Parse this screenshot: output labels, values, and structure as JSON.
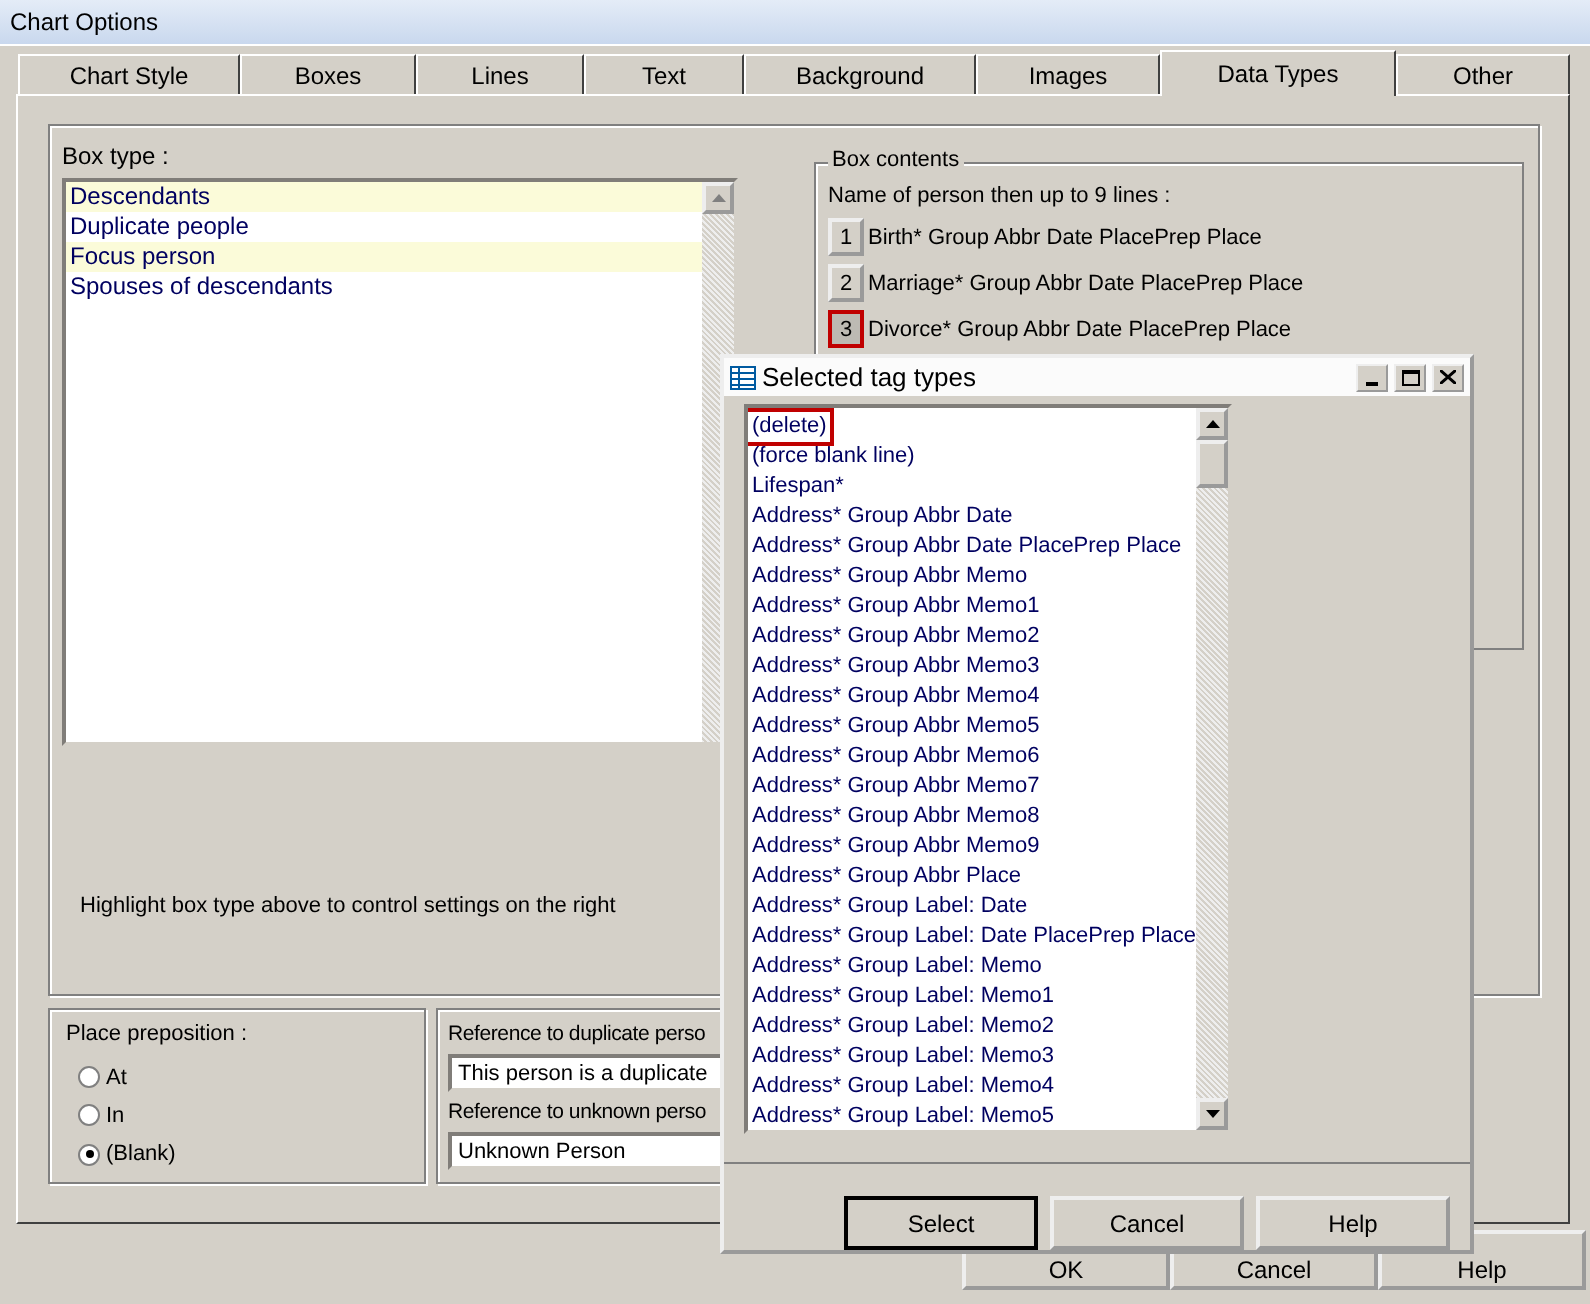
{
  "window": {
    "title": "Chart Options"
  },
  "tabs": [
    {
      "label": "Chart Style",
      "selected": false
    },
    {
      "label": "Boxes",
      "selected": false
    },
    {
      "label": "Lines",
      "selected": false
    },
    {
      "label": "Text",
      "selected": false
    },
    {
      "label": "Background",
      "selected": false
    },
    {
      "label": "Images",
      "selected": false
    },
    {
      "label": "Data Types",
      "selected": true
    },
    {
      "label": "Other",
      "selected": false
    }
  ],
  "box_type": {
    "label": "Box type :",
    "items": [
      {
        "label": "Descendants",
        "highlighted": true
      },
      {
        "label": "Duplicate people",
        "highlighted": false
      },
      {
        "label": "Focus person",
        "highlighted": true
      },
      {
        "label": "Spouses of descendants",
        "highlighted": false
      }
    ]
  },
  "box_contents": {
    "title": "Box contents",
    "subtitle": "Name of person then up to 9 lines :",
    "lines": [
      {
        "number": "1",
        "text": "Birth* Group Abbr Date PlacePrep Place",
        "marked": false
      },
      {
        "number": "2",
        "text": "Marriage* Group Abbr Date PlacePrep Place",
        "marked": false
      },
      {
        "number": "3",
        "text": "Divorce* Group Abbr Date PlacePrep Place",
        "marked": true
      }
    ]
  },
  "hint": "Highlight box type above to control settings on the right",
  "place_preposition": {
    "label": "Place preposition :",
    "options": [
      {
        "label": "At",
        "selected": false
      },
      {
        "label": "In",
        "selected": false
      },
      {
        "label": "(Blank)",
        "selected": true
      }
    ]
  },
  "references": [
    {
      "label": "Reference to duplicate perso",
      "value": "This person is a duplicate"
    },
    {
      "label": "Reference to unknown perso",
      "value": "Unknown Person"
    }
  ],
  "buttons": [
    "OK",
    "Cancel",
    "Help"
  ],
  "popup": {
    "title": "Selected tag types",
    "items": [
      {
        "label": "(delete)",
        "marked": true
      },
      {
        "label": "(force blank line)",
        "marked": false
      },
      {
        "label": "Lifespan*",
        "marked": false
      },
      {
        "label": "Address* Group Abbr Date",
        "marked": false
      },
      {
        "label": "Address* Group Abbr Date PlacePrep Place",
        "marked": false
      },
      {
        "label": "Address* Group Abbr Memo",
        "marked": false
      },
      {
        "label": "Address* Group Abbr Memo1",
        "marked": false
      },
      {
        "label": "Address* Group Abbr Memo2",
        "marked": false
      },
      {
        "label": "Address* Group Abbr Memo3",
        "marked": false
      },
      {
        "label": "Address* Group Abbr Memo4",
        "marked": false
      },
      {
        "label": "Address* Group Abbr Memo5",
        "marked": false
      },
      {
        "label": "Address* Group Abbr Memo6",
        "marked": false
      },
      {
        "label": "Address* Group Abbr Memo7",
        "marked": false
      },
      {
        "label": "Address* Group Abbr Memo8",
        "marked": false
      },
      {
        "label": "Address* Group Abbr Memo9",
        "marked": false
      },
      {
        "label": "Address* Group Abbr Place",
        "marked": false
      },
      {
        "label": "Address* Group Label: Date",
        "marked": false
      },
      {
        "label": "Address* Group Label: Date PlacePrep Place",
        "marked": false
      },
      {
        "label": "Address* Group Label: Memo",
        "marked": false
      },
      {
        "label": "Address* Group Label: Memo1",
        "marked": false
      },
      {
        "label": "Address* Group Label: Memo2",
        "marked": false
      },
      {
        "label": "Address* Group Label: Memo3",
        "marked": false
      },
      {
        "label": "Address* Group Label: Memo4",
        "marked": false
      },
      {
        "label": "Address* Group Label: Memo5",
        "marked": false
      }
    ],
    "buttons": [
      {
        "label": "Select",
        "default": true
      },
      {
        "label": "Cancel",
        "default": false
      },
      {
        "label": "Help",
        "default": false
      }
    ]
  }
}
